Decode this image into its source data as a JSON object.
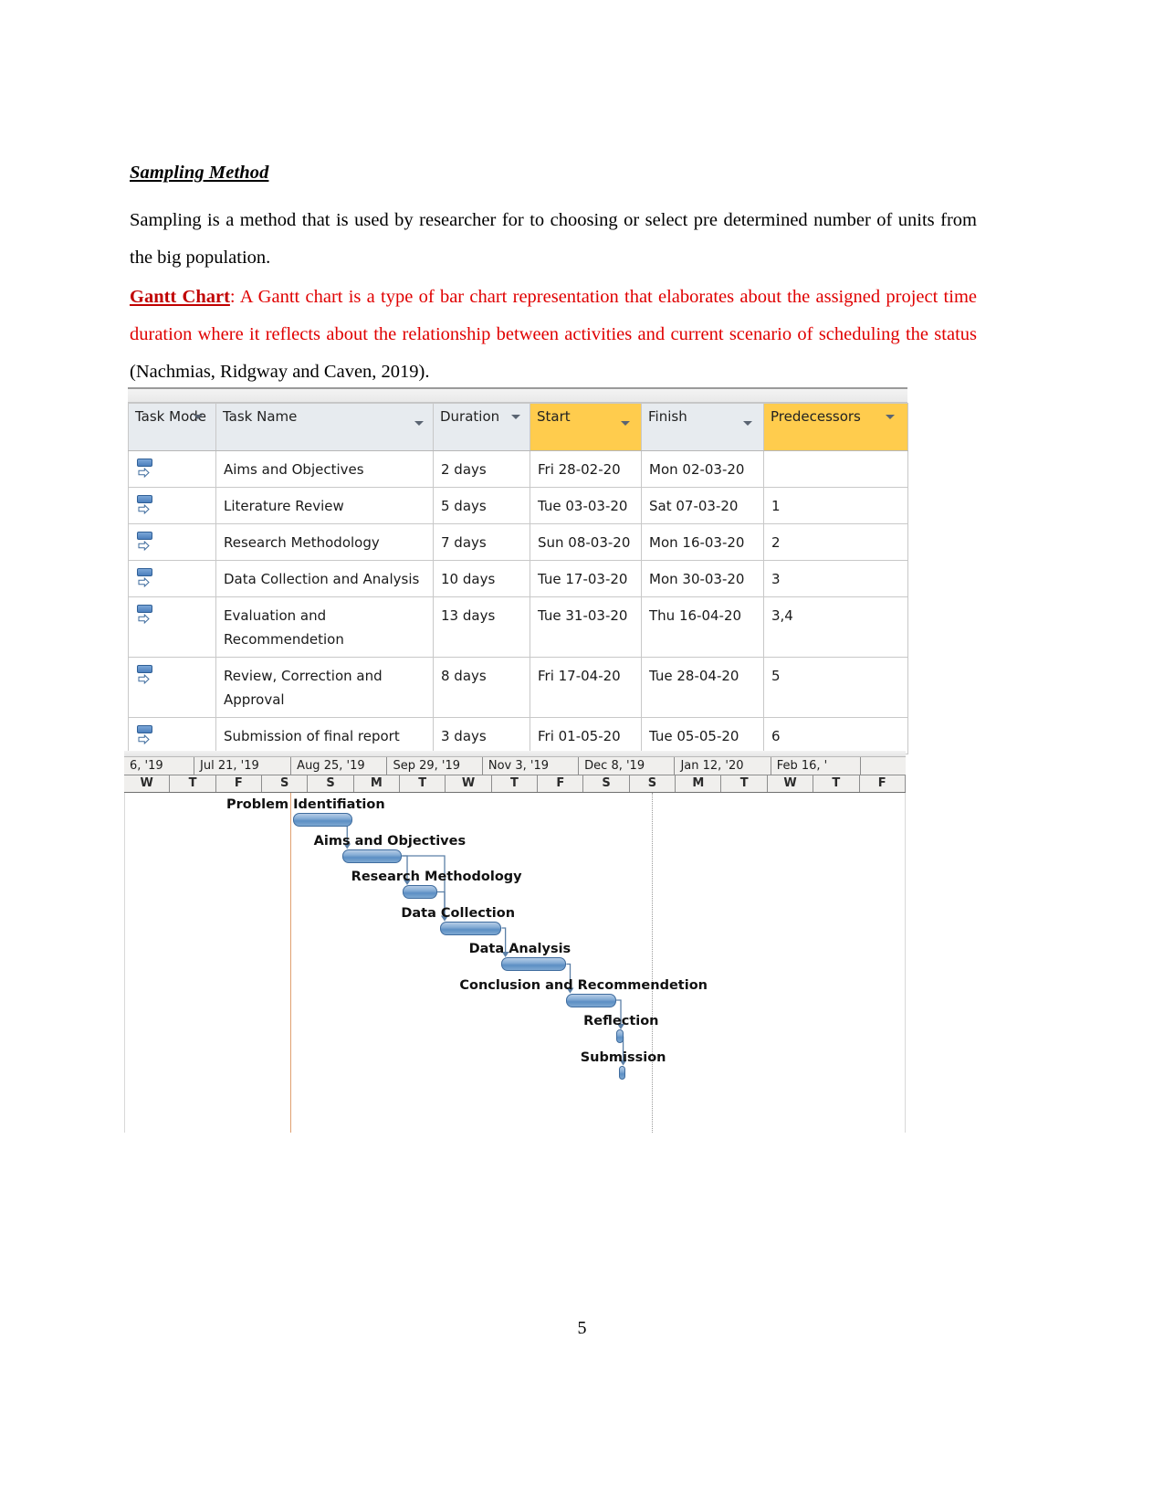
{
  "document": {
    "section_title": "Sampling Method",
    "paragraph_1": "Sampling is a method that is used by researcher for to choosing or select pre determined number of units from the big population.",
    "gantt_lead": "Gantt Chart",
    "gantt_lead_colon": ":",
    "gantt_definition": " A Gantt chart is a type of bar chart representation that elaborates about the assigned project time duration where it reflects about the relationship between activities and current scenario of scheduling the status ",
    "citation": "(Nachmias, Ridgway and Caven, 2019).",
    "page_number": "5"
  },
  "project_table": {
    "columns": [
      {
        "label": "Task Mode",
        "highlight": false
      },
      {
        "label": "Task Name",
        "highlight": false
      },
      {
        "label": "Duration",
        "highlight": false
      },
      {
        "label": "Start",
        "highlight": true
      },
      {
        "label": "Finish",
        "highlight": false
      },
      {
        "label": "Predecessors",
        "highlight": true
      }
    ],
    "rows": [
      {
        "mode": "auto-schedule-icon",
        "name": "Aims and Objectives",
        "duration": "2 days",
        "start": "Fri 28-02-20",
        "finish": "Mon 02-03-20",
        "predecessors": ""
      },
      {
        "mode": "auto-schedule-icon",
        "name": "Literature Review",
        "duration": "5 days",
        "start": "Tue 03-03-20",
        "finish": "Sat 07-03-20",
        "predecessors": "1"
      },
      {
        "mode": "auto-schedule-icon",
        "name": "Research Methodology",
        "duration": "7 days",
        "start": "Sun 08-03-20",
        "finish": "Mon 16-03-20",
        "predecessors": "2"
      },
      {
        "mode": "auto-schedule-icon",
        "name": "Data Collection and Analysis",
        "duration": "10 days",
        "start": "Tue 17-03-20",
        "finish": "Mon 30-03-20",
        "predecessors": "3"
      },
      {
        "mode": "auto-schedule-icon",
        "name": "Evaluation and Recommendetion",
        "duration": "13 days",
        "start": "Tue 31-03-20",
        "finish": "Thu 16-04-20",
        "predecessors": "3,4"
      },
      {
        "mode": "auto-schedule-icon",
        "name": "Review, Correction and Approval",
        "duration": "8 days",
        "start": "Fri 17-04-20",
        "finish": "Tue 28-04-20",
        "predecessors": "5"
      },
      {
        "mode": "auto-schedule-icon",
        "name": "Submission of final report",
        "duration": "3 days",
        "start": "Fri 01-05-20",
        "finish": "Tue 05-05-20",
        "predecessors": "6"
      }
    ]
  },
  "chart_data": {
    "type": "bar",
    "title": "Gantt Chart",
    "xlabel": "",
    "ylabel": "",
    "timeline_months": [
      "6, '19",
      "Jul 21, '19",
      "Aug 25, '19",
      "Sep 29, '19",
      "Nov 3, '19",
      "Dec 8, '19",
      "Jan 12, '20",
      "Feb 16, '"
    ],
    "timeline_days": [
      "W",
      "T",
      "F",
      "S",
      "S",
      "M",
      "T",
      "W",
      "T",
      "F",
      "S",
      "S",
      "M",
      "T",
      "W",
      "T",
      "F"
    ],
    "categories": [
      "Problem Identifiation",
      "Aims and Objectives",
      "Research Methodology",
      "Data Collection",
      "Data Analysis",
      "Conclusion and Recommendetion",
      "Reflection",
      "Submission"
    ],
    "bars": [
      {
        "label": "Problem Identifiation",
        "start_pct": 21.5,
        "width_pct": 7.6,
        "row": 0
      },
      {
        "label": "Aims and Objectives",
        "start_pct": 27.9,
        "width_pct": 7.6,
        "row": 1
      },
      {
        "label": "Research Methodology",
        "start_pct": 35.6,
        "width_pct": 4.4,
        "row": 2
      },
      {
        "label": "Data Collection",
        "start_pct": 40.4,
        "width_pct": 7.9,
        "row": 3
      },
      {
        "label": "Data Analysis",
        "start_pct": 48.2,
        "width_pct": 8.4,
        "row": 4
      },
      {
        "label": "Conclusion and Recommendetion",
        "start_pct": 56.5,
        "width_pct": 6.5,
        "row": 5
      },
      {
        "label": "Reflection",
        "start_pct": 63.0,
        "width_pct": 0.9,
        "row": 6
      },
      {
        "label": "Submission",
        "start_pct": 63.3,
        "width_pct": 0.9,
        "row": 7
      }
    ],
    "gridlines": true,
    "legend_position": "none"
  },
  "colors": {
    "accent_red": "#e00000",
    "header_highlight": "#ffcc4d",
    "bar_fill": "#5c8fc4",
    "bar_border": "#3f6c9e",
    "row_shade": "#e8eff9"
  }
}
